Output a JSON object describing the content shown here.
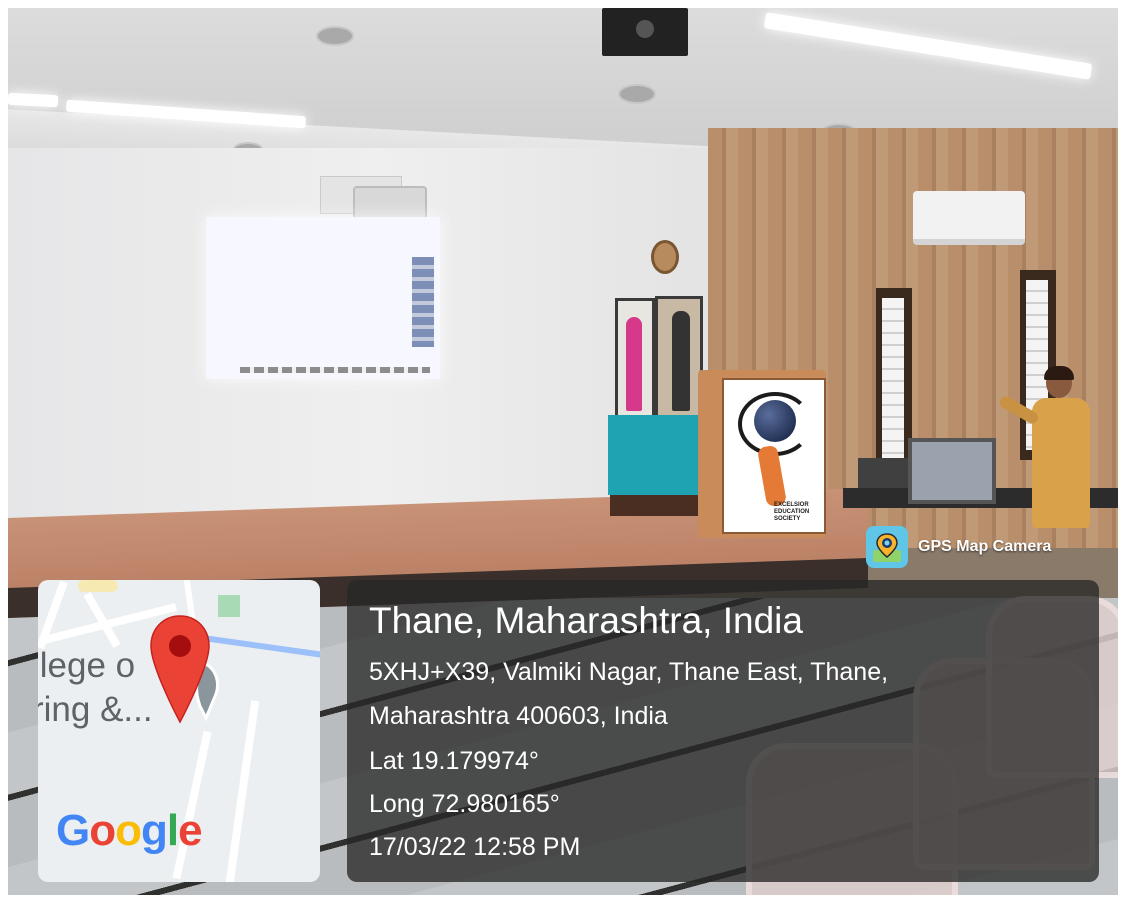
{
  "watermark": {
    "app_label": "GPS Map Camera",
    "icon": "gps-map-camera-app-icon"
  },
  "map": {
    "label_line1": "llege o",
    "label_line2": "ring &...",
    "attribution": "Google",
    "pin_icon": "location-pin-icon",
    "colors": {
      "pin": "#ea4335",
      "google_blue": "#4285f4",
      "google_red": "#ea4335",
      "google_yellow": "#fbbc05",
      "google_green": "#34a853"
    }
  },
  "location": {
    "title": "Thane, Maharashtra, India",
    "address_line1": "5XHJ+X39, Valmiki Nagar, Thane East, Thane,",
    "address_line2": "Maharashtra 400603, India",
    "latitude": "Lat 19.179974°",
    "longitude": "Long 72.980165°",
    "timestamp": "17/03/22 12:58 PM"
  },
  "podium": {
    "logo_text": "EXCELSIOR EDUCATION SOCIETY"
  }
}
